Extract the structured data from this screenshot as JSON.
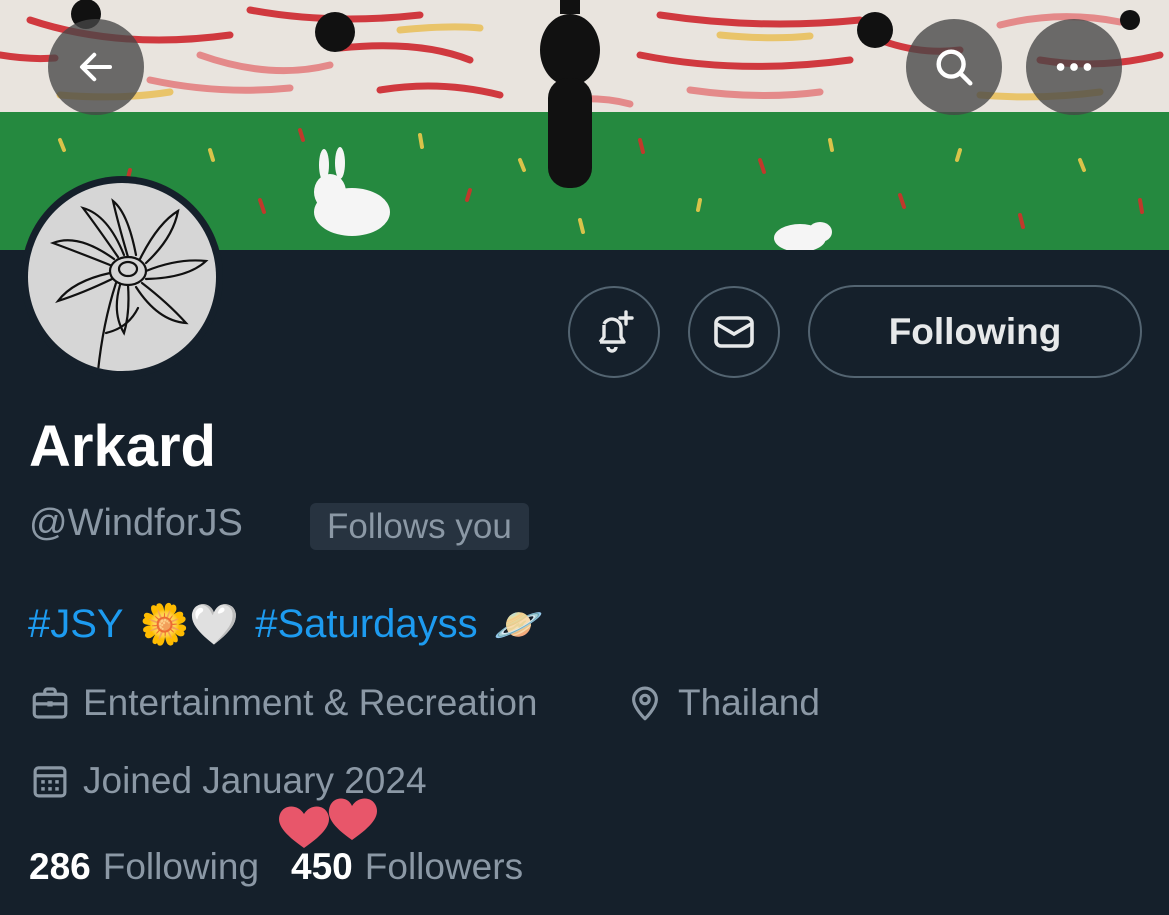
{
  "banner": {
    "back_icon": "arrow-left-icon",
    "search_icon": "search-icon",
    "more_icon": "more-horizontal-icon"
  },
  "profile": {
    "display_name": "Arkard",
    "handle": "@WindforJS",
    "follows_you_badge": "Follows you",
    "avatar_icon": "daisy-flower-icon"
  },
  "actions": {
    "notify_icon": "bell-plus-icon",
    "message_icon": "envelope-icon",
    "following_label": "Following"
  },
  "bio": {
    "hashtag_1": "#JSY",
    "emoji_1": "🌼🤍",
    "hashtag_2": "#Saturdayss",
    "emoji_2": "🪐"
  },
  "meta": {
    "category": "Entertainment & Recreation",
    "category_icon": "briefcase-icon",
    "location": "Thailand",
    "location_icon": "location-pin-icon",
    "joined": "Joined January 2024",
    "joined_icon": "calendar-icon"
  },
  "stats": {
    "following_count": "286",
    "following_label": "Following",
    "followers_count": "450",
    "followers_label": "Followers"
  },
  "colors": {
    "background": "#15202b",
    "accent": "#1d9bf0",
    "secondary_text": "#8b98a5",
    "border": "#536471"
  }
}
